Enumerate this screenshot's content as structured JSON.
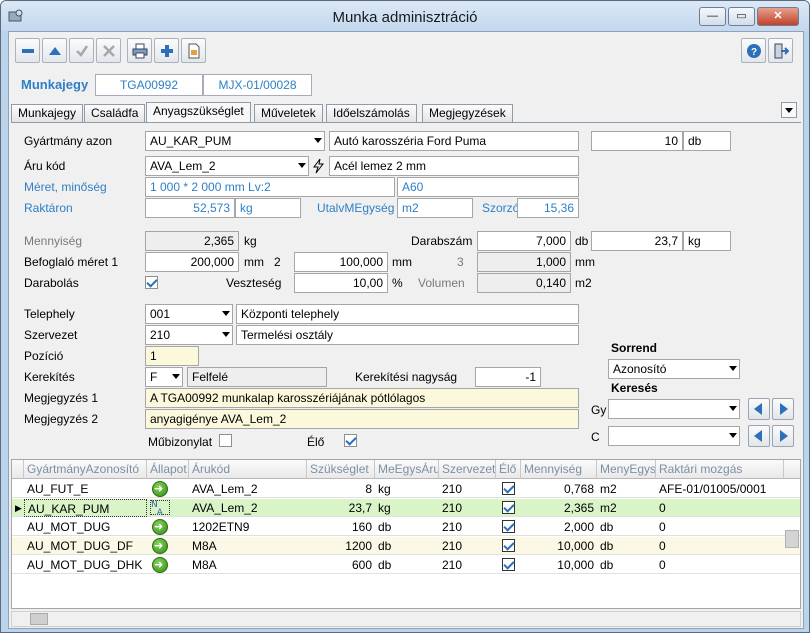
{
  "window": {
    "title": "Munka adminisztráció",
    "min": "—",
    "max": "▭",
    "close": "✕"
  },
  "docbar": {
    "label": "Munkajegy",
    "doc_no": "TGA00992",
    "ref": "MJX-01/00028"
  },
  "tabs": [
    "Munkajegy",
    "Családfa",
    "Anyagszükséglet",
    "Műveletek",
    "Időelszámolás",
    "Megjegyzések"
  ],
  "active_tab": 2,
  "form": {
    "gyartmany_label": "Gyártmány azon",
    "gyartmany_value": "AU_KAR_PUM",
    "gyartmany_desc": "Autó karosszéria Ford Puma",
    "qty_value": "10",
    "qty_unit": "db",
    "aru_label": "Áru kód",
    "aru_value": "AVA_Lem_2",
    "aru_desc": "Acél lemez 2 mm",
    "meret_label": "Méret, minőség",
    "meret_value": "1 000 * 2 000 mm Lv:2",
    "meret_code": "A60",
    "raktaron_label": "Raktáron",
    "raktaron_value": "52,573",
    "raktaron_unit": "kg",
    "utalv_label": "UtalvMEgység",
    "utalv_value": "m2",
    "szorzo_label": "Szorzó",
    "szorzo_value": "15,36",
    "mennyiseg_label": "Mennyiség",
    "mennyiseg_value": "2,365",
    "mennyiseg_unit": "kg",
    "darabszam_label": "Darabszám",
    "darabszam_value": "7,000",
    "darabszam_unit": "db",
    "darabszam_kg": "23,7",
    "darabszam_kg_unit": "kg",
    "befoglalo_label": "Befoglaló méret 1",
    "befoglalo1_value": "200,000",
    "befoglalo1_unit": "mm",
    "befoglalo2_label": "2",
    "befoglalo2_value": "100,000",
    "befoglalo2_unit": "mm",
    "befoglalo3_label": "3",
    "befoglalo3_value": "1,000",
    "befoglalo3_unit": "mm",
    "darabolas_label": "Darabolás",
    "veszteseg_label": "Veszteség",
    "veszteseg_value": "10,00",
    "veszteseg_unit": "%",
    "volumen_label": "Volumen",
    "volumen_value": "0,140",
    "volumen_unit": "m2",
    "telephely_label": "Telephely",
    "telephely_value": "001",
    "telephely_desc": "Központi telephely",
    "szervezet_label": "Szervezet",
    "szervezet_value": "210",
    "szervezet_desc": "Termelési osztály",
    "pozicio_label": "Pozíció",
    "pozicio_value": "1",
    "kerekites_label": "Kerekítés",
    "kerekites_value": "F",
    "kerekites_desc": "Felfelé",
    "kerek_nagysag_label": "Kerekítési nagyság",
    "kerek_nagysag_value": "-1",
    "megj1_label": "Megjegyzés 1",
    "megj1_value": "A TGA00992 munkalap karosszériájának pótlólagos",
    "megj2_label": "Megjegyzés 2",
    "megj2_value": "anyagigénye AVA_Lem_2",
    "mubizonylat_label": "Műbizonylat",
    "elo_label": "Élő"
  },
  "sort": {
    "sorrend_label": "Sorrend",
    "sorrend_value": "Azonosító",
    "kereses_label": "Keresés",
    "gy_label": "Gy",
    "c_label": "C"
  },
  "grid": {
    "headers": [
      "GyártmányAzonosító",
      "Állapot",
      "Árukód",
      "Szükséglet",
      "MeEgysÁru",
      "Szervezet",
      "Élő",
      "Mennyiség",
      "MenyEgys",
      "Raktári mozgás"
    ],
    "rows": [
      {
        "gyartmany": "AU_FUT_E",
        "allapot": "ok",
        "arukod": "AVA_Lem_2",
        "szukseglet": "8",
        "me": "kg",
        "szervezet": "210",
        "elo": true,
        "mennyiseg": "0,768",
        "menyegys": "m2",
        "mozgas": "AFE-01/01005/0001"
      },
      {
        "gyartmany": "AU_KAR_PUM",
        "allapot": "na",
        "arukod": "AVA_Lem_2",
        "szukseglet": "23,7",
        "me": "kg",
        "szervezet": "210",
        "elo": true,
        "mennyiseg": "2,365",
        "menyegys": "m2",
        "mozgas": "0"
      },
      {
        "gyartmany": "AU_MOT_DUG",
        "allapot": "ok",
        "arukod": "1202ETN9",
        "szukseglet": "160",
        "me": "db",
        "szervezet": "210",
        "elo": true,
        "mennyiseg": "2,000",
        "menyegys": "db",
        "mozgas": "0"
      },
      {
        "gyartmany": "AU_MOT_DUG_DF",
        "allapot": "ok",
        "arukod": "M8A",
        "szukseglet": "1200",
        "me": "db",
        "szervezet": "210",
        "elo": true,
        "mennyiseg": "10,000",
        "menyegys": "db",
        "mozgas": "0"
      },
      {
        "gyartmany": "AU_MOT_DUG_DHK",
        "allapot": "ok",
        "arukod": "M8A",
        "szukseglet": "600",
        "me": "db",
        "szervezet": "210",
        "elo": true,
        "mennyiseg": "10,000",
        "menyegys": "db",
        "mozgas": "0"
      }
    ],
    "selected_row": 1
  },
  "colors": {
    "accent": "#2e7fc6",
    "selected_row": "#d9f5c8",
    "alt_row": "#fbf8e6"
  }
}
